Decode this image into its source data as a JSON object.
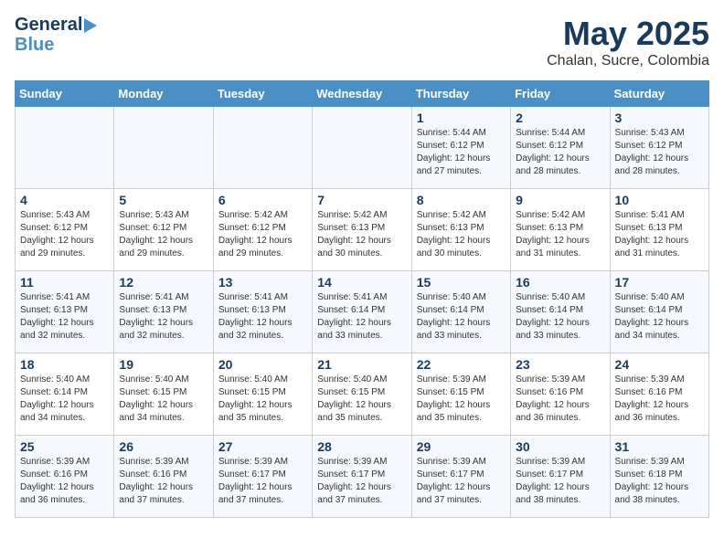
{
  "header": {
    "logo_line1": "General",
    "logo_line2": "Blue",
    "title": "May 2025",
    "subtitle": "Chalan, Sucre, Colombia"
  },
  "weekdays": [
    "Sunday",
    "Monday",
    "Tuesday",
    "Wednesday",
    "Thursday",
    "Friday",
    "Saturday"
  ],
  "weeks": [
    [
      {
        "day": "",
        "info": ""
      },
      {
        "day": "",
        "info": ""
      },
      {
        "day": "",
        "info": ""
      },
      {
        "day": "",
        "info": ""
      },
      {
        "day": "1",
        "info": "Sunrise: 5:44 AM\nSunset: 6:12 PM\nDaylight: 12 hours\nand 27 minutes."
      },
      {
        "day": "2",
        "info": "Sunrise: 5:44 AM\nSunset: 6:12 PM\nDaylight: 12 hours\nand 28 minutes."
      },
      {
        "day": "3",
        "info": "Sunrise: 5:43 AM\nSunset: 6:12 PM\nDaylight: 12 hours\nand 28 minutes."
      }
    ],
    [
      {
        "day": "4",
        "info": "Sunrise: 5:43 AM\nSunset: 6:12 PM\nDaylight: 12 hours\nand 29 minutes."
      },
      {
        "day": "5",
        "info": "Sunrise: 5:43 AM\nSunset: 6:12 PM\nDaylight: 12 hours\nand 29 minutes."
      },
      {
        "day": "6",
        "info": "Sunrise: 5:42 AM\nSunset: 6:12 PM\nDaylight: 12 hours\nand 29 minutes."
      },
      {
        "day": "7",
        "info": "Sunrise: 5:42 AM\nSunset: 6:13 PM\nDaylight: 12 hours\nand 30 minutes."
      },
      {
        "day": "8",
        "info": "Sunrise: 5:42 AM\nSunset: 6:13 PM\nDaylight: 12 hours\nand 30 minutes."
      },
      {
        "day": "9",
        "info": "Sunrise: 5:42 AM\nSunset: 6:13 PM\nDaylight: 12 hours\nand 31 minutes."
      },
      {
        "day": "10",
        "info": "Sunrise: 5:41 AM\nSunset: 6:13 PM\nDaylight: 12 hours\nand 31 minutes."
      }
    ],
    [
      {
        "day": "11",
        "info": "Sunrise: 5:41 AM\nSunset: 6:13 PM\nDaylight: 12 hours\nand 32 minutes."
      },
      {
        "day": "12",
        "info": "Sunrise: 5:41 AM\nSunset: 6:13 PM\nDaylight: 12 hours\nand 32 minutes."
      },
      {
        "day": "13",
        "info": "Sunrise: 5:41 AM\nSunset: 6:13 PM\nDaylight: 12 hours\nand 32 minutes."
      },
      {
        "day": "14",
        "info": "Sunrise: 5:41 AM\nSunset: 6:14 PM\nDaylight: 12 hours\nand 33 minutes."
      },
      {
        "day": "15",
        "info": "Sunrise: 5:40 AM\nSunset: 6:14 PM\nDaylight: 12 hours\nand 33 minutes."
      },
      {
        "day": "16",
        "info": "Sunrise: 5:40 AM\nSunset: 6:14 PM\nDaylight: 12 hours\nand 33 minutes."
      },
      {
        "day": "17",
        "info": "Sunrise: 5:40 AM\nSunset: 6:14 PM\nDaylight: 12 hours\nand 34 minutes."
      }
    ],
    [
      {
        "day": "18",
        "info": "Sunrise: 5:40 AM\nSunset: 6:14 PM\nDaylight: 12 hours\nand 34 minutes."
      },
      {
        "day": "19",
        "info": "Sunrise: 5:40 AM\nSunset: 6:15 PM\nDaylight: 12 hours\nand 34 minutes."
      },
      {
        "day": "20",
        "info": "Sunrise: 5:40 AM\nSunset: 6:15 PM\nDaylight: 12 hours\nand 35 minutes."
      },
      {
        "day": "21",
        "info": "Sunrise: 5:40 AM\nSunset: 6:15 PM\nDaylight: 12 hours\nand 35 minutes."
      },
      {
        "day": "22",
        "info": "Sunrise: 5:39 AM\nSunset: 6:15 PM\nDaylight: 12 hours\nand 35 minutes."
      },
      {
        "day": "23",
        "info": "Sunrise: 5:39 AM\nSunset: 6:16 PM\nDaylight: 12 hours\nand 36 minutes."
      },
      {
        "day": "24",
        "info": "Sunrise: 5:39 AM\nSunset: 6:16 PM\nDaylight: 12 hours\nand 36 minutes."
      }
    ],
    [
      {
        "day": "25",
        "info": "Sunrise: 5:39 AM\nSunset: 6:16 PM\nDaylight: 12 hours\nand 36 minutes."
      },
      {
        "day": "26",
        "info": "Sunrise: 5:39 AM\nSunset: 6:16 PM\nDaylight: 12 hours\nand 37 minutes."
      },
      {
        "day": "27",
        "info": "Sunrise: 5:39 AM\nSunset: 6:17 PM\nDaylight: 12 hours\nand 37 minutes."
      },
      {
        "day": "28",
        "info": "Sunrise: 5:39 AM\nSunset: 6:17 PM\nDaylight: 12 hours\nand 37 minutes."
      },
      {
        "day": "29",
        "info": "Sunrise: 5:39 AM\nSunset: 6:17 PM\nDaylight: 12 hours\nand 37 minutes."
      },
      {
        "day": "30",
        "info": "Sunrise: 5:39 AM\nSunset: 6:17 PM\nDaylight: 12 hours\nand 38 minutes."
      },
      {
        "day": "31",
        "info": "Sunrise: 5:39 AM\nSunset: 6:18 PM\nDaylight: 12 hours\nand 38 minutes."
      }
    ]
  ]
}
